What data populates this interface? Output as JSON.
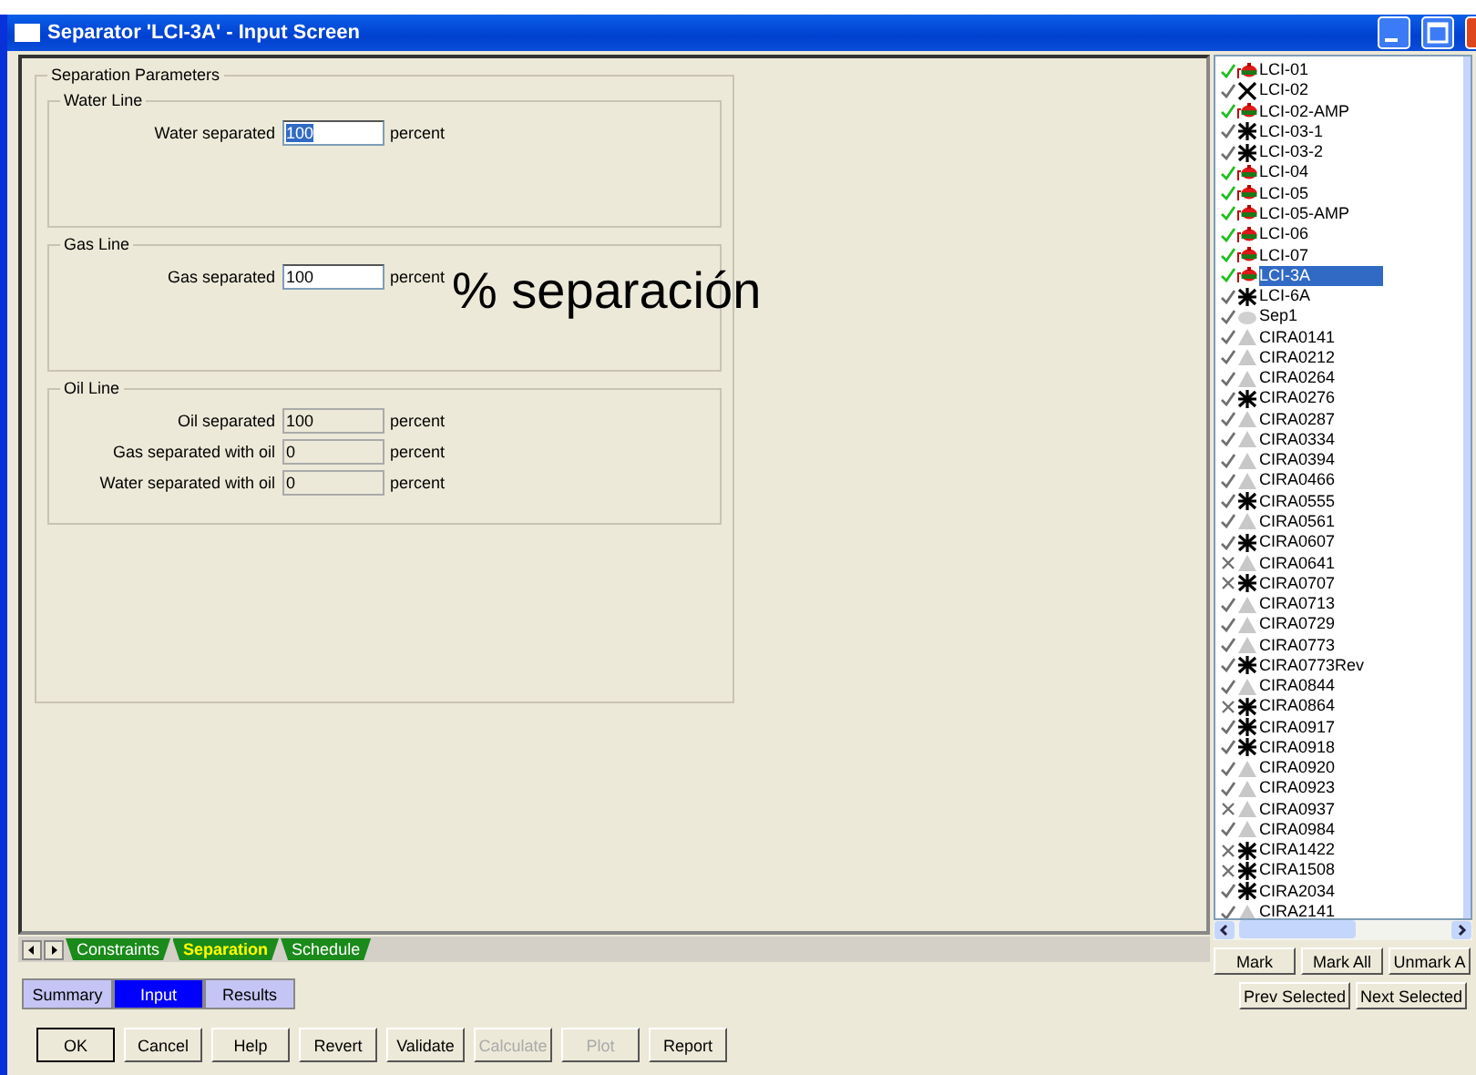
{
  "window": {
    "title": "Separator 'LCI-3A' - Input Screen"
  },
  "annotation": "% separación",
  "parameters": {
    "title": "Separation Parameters",
    "groups": [
      {
        "title": "Water Line",
        "fields": [
          {
            "label": "Water separated",
            "value": "100",
            "unit": "percent",
            "disabled": false,
            "highlighted": true
          }
        ]
      },
      {
        "title": "Gas Line",
        "fields": [
          {
            "label": "Gas separated",
            "value": "100",
            "unit": "percent",
            "disabled": false,
            "highlighted": false
          }
        ]
      },
      {
        "title": "Oil Line",
        "fields": [
          {
            "label": "Oil separated",
            "value": "100",
            "unit": "percent",
            "disabled": true,
            "highlighted": false
          },
          {
            "label": "Gas separated with oil",
            "value": "0",
            "unit": "percent",
            "disabled": true,
            "highlighted": false
          },
          {
            "label": "Water separated with oil",
            "value": "0",
            "unit": "percent",
            "disabled": true,
            "highlighted": false
          }
        ]
      }
    ]
  },
  "sheet_tabs": [
    {
      "label": "Constraints",
      "selected": false
    },
    {
      "label": "Separation",
      "selected": true
    },
    {
      "label": "Schedule",
      "selected": false
    }
  ],
  "view_buttons": [
    {
      "label": "Summary",
      "selected": false
    },
    {
      "label": "Input",
      "selected": true
    },
    {
      "label": "Results",
      "selected": false
    }
  ],
  "buttons": [
    {
      "label": "OK",
      "disabled": false
    },
    {
      "label": "Cancel",
      "disabled": false
    },
    {
      "label": "Help",
      "disabled": false
    },
    {
      "label": "Revert",
      "disabled": false
    },
    {
      "label": "Validate",
      "disabled": false
    },
    {
      "label": "Calculate",
      "disabled": true
    },
    {
      "label": "Plot",
      "disabled": true
    },
    {
      "label": "Report",
      "disabled": false
    }
  ],
  "objects": [
    {
      "name": "LCI-01",
      "excluded": false,
      "color": "#1fbf1f",
      "kind": "separator",
      "selected": false
    },
    {
      "name": "LCI-02",
      "excluded": false,
      "color": "#707070",
      "kind": "cross",
      "selected": false
    },
    {
      "name": "LCI-02-AMP",
      "excluded": false,
      "color": "#1fbf1f",
      "kind": "separator",
      "selected": false
    },
    {
      "name": "LCI-03-1",
      "excluded": false,
      "color": "#707070",
      "kind": "asterisk",
      "selected": false
    },
    {
      "name": "LCI-03-2",
      "excluded": false,
      "color": "#707070",
      "kind": "asterisk",
      "selected": false
    },
    {
      "name": "LCI-04",
      "excluded": false,
      "color": "#1fbf1f",
      "kind": "separator",
      "selected": false
    },
    {
      "name": "LCI-05",
      "excluded": false,
      "color": "#1fbf1f",
      "kind": "separator",
      "selected": false
    },
    {
      "name": "LCI-05-AMP",
      "excluded": false,
      "color": "#1fbf1f",
      "kind": "separator",
      "selected": false
    },
    {
      "name": "LCI-06",
      "excluded": false,
      "color": "#1fbf1f",
      "kind": "separator",
      "selected": false
    },
    {
      "name": "LCI-07",
      "excluded": false,
      "color": "#1fbf1f",
      "kind": "separator",
      "selected": false
    },
    {
      "name": "LCI-3A",
      "excluded": false,
      "color": "#1fbf1f",
      "kind": "separator",
      "selected": true
    },
    {
      "name": "LCI-6A",
      "excluded": false,
      "color": "#707070",
      "kind": "asterisk",
      "selected": false
    },
    {
      "name": "Sep1",
      "excluded": false,
      "color": "#707070",
      "kind": "cloud",
      "selected": false
    },
    {
      "name": "CIRA0141",
      "excluded": false,
      "color": "#707070",
      "kind": "triangle",
      "selected": false
    },
    {
      "name": "CIRA0212",
      "excluded": false,
      "color": "#707070",
      "kind": "triangle",
      "selected": false
    },
    {
      "name": "CIRA0264",
      "excluded": false,
      "color": "#707070",
      "kind": "triangle",
      "selected": false
    },
    {
      "name": "CIRA0276",
      "excluded": false,
      "color": "#707070",
      "kind": "asterisk",
      "selected": false
    },
    {
      "name": "CIRA0287",
      "excluded": false,
      "color": "#707070",
      "kind": "triangle",
      "selected": false
    },
    {
      "name": "CIRA0334",
      "excluded": false,
      "color": "#707070",
      "kind": "triangle",
      "selected": false
    },
    {
      "name": "CIRA0394",
      "excluded": false,
      "color": "#707070",
      "kind": "triangle",
      "selected": false
    },
    {
      "name": "CIRA0466",
      "excluded": false,
      "color": "#707070",
      "kind": "triangle",
      "selected": false
    },
    {
      "name": "CIRA0555",
      "excluded": false,
      "color": "#707070",
      "kind": "asterisk",
      "selected": false
    },
    {
      "name": "CIRA0561",
      "excluded": false,
      "color": "#707070",
      "kind": "triangle",
      "selected": false
    },
    {
      "name": "CIRA0607",
      "excluded": false,
      "color": "#707070",
      "kind": "asterisk",
      "selected": false
    },
    {
      "name": "CIRA0641",
      "excluded": true,
      "color": "#707070",
      "kind": "triangle",
      "selected": false
    },
    {
      "name": "CIRA0707",
      "excluded": true,
      "color": "#707070",
      "kind": "asterisk",
      "selected": false
    },
    {
      "name": "CIRA0713",
      "excluded": false,
      "color": "#707070",
      "kind": "triangle",
      "selected": false
    },
    {
      "name": "CIRA0729",
      "excluded": false,
      "color": "#707070",
      "kind": "triangle",
      "selected": false
    },
    {
      "name": "CIRA0773",
      "excluded": false,
      "color": "#707070",
      "kind": "triangle",
      "selected": false
    },
    {
      "name": "CIRA0773Rev",
      "excluded": false,
      "color": "#707070",
      "kind": "asterisk",
      "selected": false
    },
    {
      "name": "CIRA0844",
      "excluded": false,
      "color": "#707070",
      "kind": "triangle",
      "selected": false
    },
    {
      "name": "CIRA0864",
      "excluded": true,
      "color": "#707070",
      "kind": "asterisk",
      "selected": false
    },
    {
      "name": "CIRA0917",
      "excluded": false,
      "color": "#707070",
      "kind": "asterisk",
      "selected": false
    },
    {
      "name": "CIRA0918",
      "excluded": false,
      "color": "#707070",
      "kind": "asterisk",
      "selected": false
    },
    {
      "name": "CIRA0920",
      "excluded": false,
      "color": "#707070",
      "kind": "triangle",
      "selected": false
    },
    {
      "name": "CIRA0923",
      "excluded": false,
      "color": "#707070",
      "kind": "triangle",
      "selected": false
    },
    {
      "name": "CIRA0937",
      "excluded": true,
      "color": "#707070",
      "kind": "triangle",
      "selected": false
    },
    {
      "name": "CIRA0984",
      "excluded": false,
      "color": "#707070",
      "kind": "triangle",
      "selected": false
    },
    {
      "name": "CIRA1422",
      "excluded": true,
      "color": "#707070",
      "kind": "asterisk",
      "selected": false
    },
    {
      "name": "CIRA1508",
      "excluded": true,
      "color": "#707070",
      "kind": "asterisk",
      "selected": false
    },
    {
      "name": "CIRA2034",
      "excluded": false,
      "color": "#707070",
      "kind": "asterisk",
      "selected": false
    },
    {
      "name": "CIRA2141",
      "excluded": false,
      "color": "#707070",
      "kind": "triangle",
      "selected": false
    }
  ],
  "list_buttons": [
    {
      "label": "Mark"
    },
    {
      "label": "Mark All"
    },
    {
      "label": "Unmark A"
    }
  ],
  "nav_buttons": [
    {
      "label": "Prev Selected"
    },
    {
      "label": "Next Selected"
    }
  ]
}
